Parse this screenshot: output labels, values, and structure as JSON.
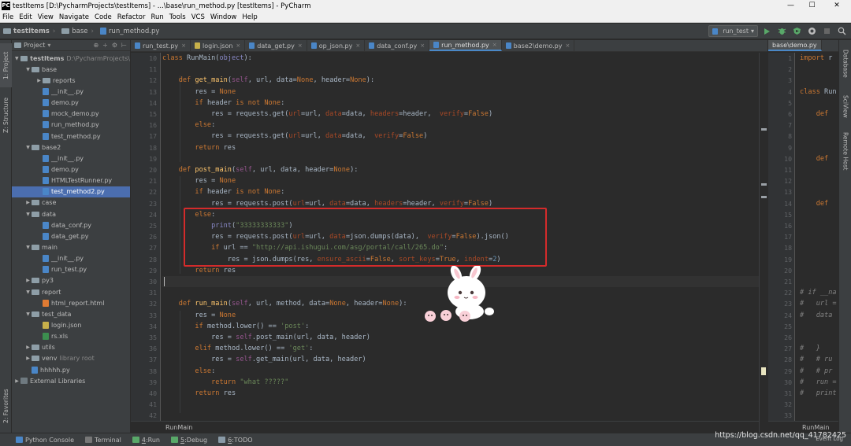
{
  "window": {
    "title": "testItems [D:\\PycharmProjects\\testItems] - ...\\base\\run_method.py [testItems] - PyCharm",
    "minimize": "—",
    "maximize": "☐",
    "close": "✕"
  },
  "menu": [
    "File",
    "Edit",
    "View",
    "Navigate",
    "Code",
    "Refactor",
    "Run",
    "Tools",
    "VCS",
    "Window",
    "Help"
  ],
  "breadcrumbs": [
    "testItems",
    "base",
    "run_method.py"
  ],
  "toolbar": {
    "run_config": "run_test",
    "run_config_arrow": "▾"
  },
  "left_strip": {
    "project_tab": "1: Project",
    "structure_tab": "Z: Structure",
    "favorites_tab": "2: Favorites"
  },
  "project_panel": {
    "header": "Project",
    "header_arrow": "▾",
    "icons": [
      "⊕",
      "÷",
      "⚙",
      "⊢"
    ],
    "tree": [
      {
        "label": "testItems",
        "note": "D:\\PycharmProjects\\",
        "type": "folder",
        "depth": 0,
        "expanded": true,
        "bold": true
      },
      {
        "label": "base",
        "type": "folder",
        "depth": 1,
        "expanded": true
      },
      {
        "label": "reports",
        "type": "folder",
        "depth": 2,
        "expanded": false
      },
      {
        "label": "__init__.py",
        "type": "py",
        "depth": 2
      },
      {
        "label": "demo.py",
        "type": "py",
        "depth": 2
      },
      {
        "label": "mock_demo.py",
        "type": "py",
        "depth": 2
      },
      {
        "label": "run_method.py",
        "type": "py",
        "depth": 2
      },
      {
        "label": "test_method.py",
        "type": "py",
        "depth": 2
      },
      {
        "label": "base2",
        "type": "folder",
        "depth": 1,
        "expanded": true
      },
      {
        "label": "__init__.py",
        "type": "py",
        "depth": 2
      },
      {
        "label": "demo.py",
        "type": "py",
        "depth": 2
      },
      {
        "label": "HTMLTestRunner.py",
        "type": "py",
        "depth": 2
      },
      {
        "label": "test_method2.py",
        "type": "py",
        "depth": 2,
        "selected": true
      },
      {
        "label": "case",
        "type": "folder",
        "depth": 1,
        "expanded": false
      },
      {
        "label": "data",
        "type": "folder",
        "depth": 1,
        "expanded": true
      },
      {
        "label": "data_conf.py",
        "type": "py",
        "depth": 2
      },
      {
        "label": "data_get.py",
        "type": "py",
        "depth": 2
      },
      {
        "label": "main",
        "type": "folder",
        "depth": 1,
        "expanded": true
      },
      {
        "label": "__init__.py",
        "type": "py",
        "depth": 2
      },
      {
        "label": "run_test.py",
        "type": "py",
        "depth": 2
      },
      {
        "label": "py3",
        "type": "folder",
        "depth": 1,
        "expanded": false
      },
      {
        "label": "report",
        "type": "folder",
        "depth": 1,
        "expanded": true
      },
      {
        "label": "html_report.html",
        "type": "html",
        "depth": 2
      },
      {
        "label": "test_data",
        "type": "folder",
        "depth": 1,
        "expanded": true
      },
      {
        "label": "login.json",
        "type": "json",
        "depth": 2
      },
      {
        "label": "rs.xls",
        "type": "xls",
        "depth": 2
      },
      {
        "label": "utils",
        "type": "folder",
        "depth": 1,
        "expanded": false
      },
      {
        "label": "venv",
        "note": "library root",
        "type": "folder",
        "depth": 1,
        "expanded": false
      },
      {
        "label": "hhhhh.py",
        "type": "py",
        "depth": 1
      },
      {
        "label": "External Libraries",
        "type": "lib",
        "depth": 0,
        "expanded": false
      }
    ]
  },
  "tabs": [
    {
      "label": "run_test.py",
      "active": false
    },
    {
      "label": "login.json",
      "active": false
    },
    {
      "label": "data_get.py",
      "active": false
    },
    {
      "label": "op_json.py",
      "active": false
    },
    {
      "label": "data_conf.py",
      "active": false
    },
    {
      "label": "run_method.py",
      "active": true
    },
    {
      "label": "base2\\demo.py",
      "active": false
    }
  ],
  "right_tab": "base\\demo.py",
  "code_lines": [
    {
      "n": "10",
      "html": "<span class=\"kw\">class </span><span class=\"dflt\">RunMain(</span><span class=\"builtin\">object</span><span class=\"dflt\">):</span>"
    },
    {
      "n": "11",
      "html": ""
    },
    {
      "n": "12",
      "html": "    <span class=\"kw\">def </span><span class=\"fn\">get_main</span><span class=\"dflt\">(</span><span class=\"self\">self</span><span class=\"dflt\">, url, data=</span><span class=\"kw\">None</span><span class=\"dflt\">, header=</span><span class=\"kw\">None</span><span class=\"dflt\">):</span>"
    },
    {
      "n": "13",
      "html": "        <span class=\"dflt\">res = </span><span class=\"kw\">None</span>"
    },
    {
      "n": "14",
      "html": "        <span class=\"kw\">if </span><span class=\"dflt\">header </span><span class=\"kw\">is not None</span><span class=\"dflt\">:</span>"
    },
    {
      "n": "15",
      "html": "            <span class=\"dflt\">res = requests.get(</span><span class=\"param\">url</span><span class=\"dflt\">=url, </span><span class=\"param\">data</span><span class=\"dflt\">=data, </span><span class=\"param\">headers</span><span class=\"dflt\">=header,  </span><span class=\"param\">verify</span><span class=\"dflt\">=</span><span class=\"kw\">False</span><span class=\"dflt\">)</span>"
    },
    {
      "n": "16",
      "html": "        <span class=\"kw\">else</span><span class=\"dflt\">:</span>"
    },
    {
      "n": "17",
      "html": "            <span class=\"dflt\">res = requests.get(</span><span class=\"param\">url</span><span class=\"dflt\">=url, </span><span class=\"param\">data</span><span class=\"dflt\">=data,  </span><span class=\"param\">verify</span><span class=\"dflt\">=</span><span class=\"kw\">False</span><span class=\"dflt\">)</span>"
    },
    {
      "n": "18",
      "html": "        <span class=\"kw\">return </span><span class=\"dflt\">res</span>"
    },
    {
      "n": "19",
      "html": ""
    },
    {
      "n": "20",
      "html": "    <span class=\"kw\">def </span><span class=\"fn\">post_main</span><span class=\"dflt\">(</span><span class=\"self\">self</span><span class=\"dflt\">, url, data, header=</span><span class=\"kw\">None</span><span class=\"dflt\">):</span>"
    },
    {
      "n": "21",
      "html": "        <span class=\"dflt\">res = </span><span class=\"kw\">None</span>"
    },
    {
      "n": "22",
      "html": "        <span class=\"kw\">if </span><span class=\"dflt\">header </span><span class=\"kw\">is not None</span><span class=\"dflt\">:</span>"
    },
    {
      "n": "23",
      "html": "            <span class=\"dflt\">res = requests.post(</span><span class=\"param\">url</span><span class=\"dflt\">=url, </span><span class=\"param\">data</span><span class=\"dflt\">=data, </span><span class=\"param\">headers</span><span class=\"dflt\">=header, </span><span class=\"param\">verify</span><span class=\"dflt\">=</span><span class=\"kw\">False</span><span class=\"dflt\">)</span>"
    },
    {
      "n": "24",
      "html": "        <span class=\"kw\">else</span><span class=\"dflt\">:</span>"
    },
    {
      "n": "25",
      "html": "            <span class=\"builtin\">print</span><span class=\"dflt\">(</span><span class=\"str\">\"33333333333\"</span><span class=\"dflt\">)</span>"
    },
    {
      "n": "26",
      "html": "            <span class=\"dflt\">res = requests.post(</span><span class=\"param\">url</span><span class=\"dflt\">=url, </span><span class=\"param\">data</span><span class=\"dflt\">=json.dumps(data),  </span><span class=\"param\">verify</span><span class=\"dflt\">=</span><span class=\"kw\">False</span><span class=\"dflt\">).json()</span>"
    },
    {
      "n": "27",
      "html": "            <span class=\"kw\">if </span><span class=\"dflt\">url == </span><span class=\"str\">\"http://api.ishugui.com/asg/portal/call/265.do\"</span><span class=\"dflt\">:</span>"
    },
    {
      "n": "28",
      "html": "                <span class=\"dflt\">res = json.dumps(res, </span><span class=\"param\">ensure_ascii</span><span class=\"dflt\">=</span><span class=\"kw\">False</span><span class=\"dflt\">, </span><span class=\"param\">sort_keys</span><span class=\"dflt\">=</span><span class=\"kw\">True</span><span class=\"dflt\">, </span><span class=\"param\">indent</span><span class=\"dflt\">=</span><span class=\"num\">2</span><span class=\"dflt\">)</span>"
    },
    {
      "n": "29",
      "html": "        <span class=\"kw\">return </span><span class=\"dflt\">res</span>"
    },
    {
      "n": "30",
      "html": ""
    },
    {
      "n": "31",
      "html": ""
    },
    {
      "n": "32",
      "html": "    <span class=\"kw\">def </span><span class=\"fn\">run_main</span><span class=\"dflt\">(</span><span class=\"self\">self</span><span class=\"dflt\">, url, method, data=</span><span class=\"kw\">None</span><span class=\"dflt\">, header=</span><span class=\"kw\">None</span><span class=\"dflt\">):</span>"
    },
    {
      "n": "33",
      "html": "        <span class=\"dflt\">res = </span><span class=\"kw\">None</span>"
    },
    {
      "n": "34",
      "html": "        <span class=\"kw\">if </span><span class=\"dflt\">method.lower() == </span><span class=\"str\">'post'</span><span class=\"dflt\">:</span>"
    },
    {
      "n": "35",
      "html": "            <span class=\"dflt\">res = </span><span class=\"self\">self</span><span class=\"dflt\">.post_main(url, data, header)</span>"
    },
    {
      "n": "36",
      "html": "        <span class=\"kw\">elif </span><span class=\"dflt\">method.lower() == </span><span class=\"str\">'get'</span><span class=\"dflt\">:</span>"
    },
    {
      "n": "37",
      "html": "            <span class=\"dflt\">res = </span><span class=\"self\">self</span><span class=\"dflt\">.get_main(url, data, header)</span>"
    },
    {
      "n": "38",
      "html": "        <span class=\"kw\">else</span><span class=\"dflt\">:</span>"
    },
    {
      "n": "39",
      "html": "            <span class=\"kw\">return </span><span class=\"str\">\"what ?????\"</span>"
    },
    {
      "n": "40",
      "html": "        <span class=\"kw\">return </span><span class=\"dflt\">res</span>"
    },
    {
      "n": "41",
      "html": ""
    },
    {
      "n": "42",
      "html": ""
    }
  ],
  "editor_breadcrumb": "RunMain",
  "right_pane": {
    "lines": [
      {
        "n": "1",
        "html": "<span class=\"kw\">import </span><span class=\"dflt\">r</span>"
      },
      {
        "n": "2",
        "html": ""
      },
      {
        "n": "3",
        "html": ""
      },
      {
        "n": "4",
        "html": "<span class=\"kw\">class </span><span class=\"dflt\">Run</span>"
      },
      {
        "n": "5",
        "html": ""
      },
      {
        "n": "6",
        "html": "    <span class=\"kw\">def</span>"
      },
      {
        "n": "7",
        "html": ""
      },
      {
        "n": "8",
        "html": ""
      },
      {
        "n": "9",
        "html": ""
      },
      {
        "n": "10",
        "html": "    <span class=\"kw\">def</span>"
      },
      {
        "n": "11",
        "html": ""
      },
      {
        "n": "12",
        "html": ""
      },
      {
        "n": "13",
        "html": ""
      },
      {
        "n": "14",
        "html": "    <span class=\"kw\">def</span>"
      },
      {
        "n": "15",
        "html": ""
      },
      {
        "n": "16",
        "html": ""
      },
      {
        "n": "17",
        "html": ""
      },
      {
        "n": "18",
        "html": ""
      },
      {
        "n": "19",
        "html": ""
      },
      {
        "n": "20",
        "html": ""
      },
      {
        "n": "21",
        "html": ""
      },
      {
        "n": "22",
        "html": "<span class=\"comment\"># if __na</span>"
      },
      {
        "n": "23",
        "html": "<span class=\"comment\">#   url =</span>"
      },
      {
        "n": "24",
        "html": "<span class=\"comment\">#   data</span>"
      },
      {
        "n": "25",
        "html": ""
      },
      {
        "n": "26",
        "html": ""
      },
      {
        "n": "27",
        "html": "<span class=\"comment\">#   }</span>"
      },
      {
        "n": "28",
        "html": "<span class=\"comment\">#   # ru</span>"
      },
      {
        "n": "29",
        "html": "<span class=\"comment\">#   # pr</span>"
      },
      {
        "n": "30",
        "html": "<span class=\"comment\">#   run =</span>"
      },
      {
        "n": "31",
        "html": "<span class=\"comment\">#   print</span>"
      },
      {
        "n": "32",
        "html": ""
      },
      {
        "n": "33",
        "html": ""
      }
    ],
    "breadcrumb": "RunMain"
  },
  "right_strip": {
    "database_tab": "Database",
    "sciview_tab": "SciView",
    "remote_host_tab": "Remote Host"
  },
  "bottom_tabs": [
    {
      "label": "Python Console",
      "mnemonic": "",
      "color": "#4a86c7"
    },
    {
      "label": "Terminal",
      "mnemonic": "",
      "color": "#777777"
    },
    {
      "label": "Run",
      "mnemonic": "4",
      "color": "#59a869"
    },
    {
      "label": "Debug",
      "mnemonic": "5",
      "color": "#59a869"
    },
    {
      "label": "TODO",
      "mnemonic": "6",
      "color": "#8a9ba8"
    }
  ],
  "watermark": "https://blog.csdn.net/qq_41782425",
  "event_log": "Event Log"
}
